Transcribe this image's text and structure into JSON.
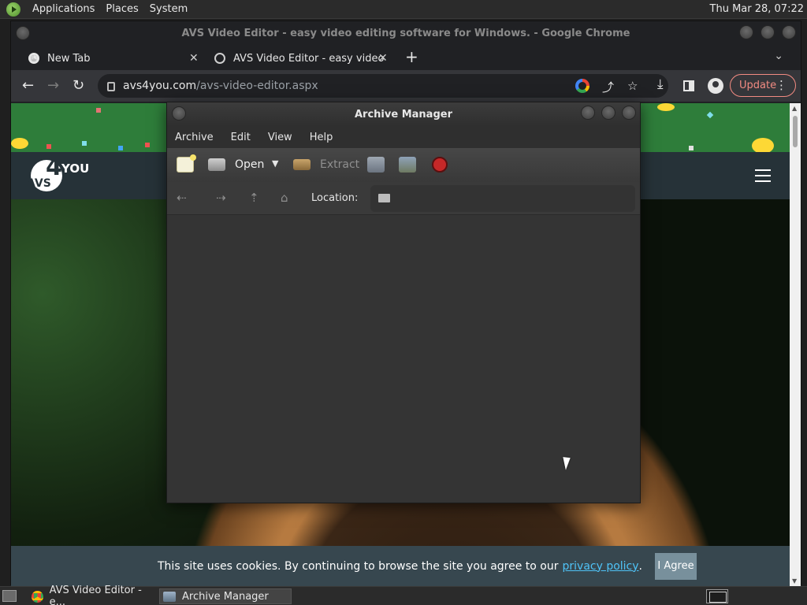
{
  "top_panel": {
    "menus": [
      "Applications",
      "Places",
      "System"
    ],
    "clock": "Thu Mar 28, 07:22"
  },
  "chrome": {
    "window_title": "AVS Video Editor - easy video editing software for Windows. - Google Chrome",
    "tabs": [
      {
        "label": "New Tab",
        "close": "✕"
      },
      {
        "label": "AVS Video Editor - easy video",
        "close": "✕"
      }
    ],
    "new_tab": "+",
    "tab_list": "⌄",
    "nav": {
      "back": "←",
      "forward": "→",
      "reload": "↻"
    },
    "url_host": "avs4you.com",
    "url_path": "/avs-video-editor.aspx",
    "icons": {
      "share": "⤴",
      "star": "☆",
      "download": "⤓"
    },
    "update_label": "Update",
    "menu_dots": "⋮"
  },
  "website": {
    "logo": {
      "avs": "AVS",
      "four": "4",
      "you": "YOU"
    },
    "cookie_text": "This site uses cookies. By continuing to browse the site you agree to our",
    "cookie_link": "privacy policy",
    "cookie_period": ".",
    "agree_label": "I Agree",
    "colors": {
      "header_bg": "#263238",
      "cookie_bg": "#37474f",
      "link": "#4fc3f7"
    }
  },
  "scrollbar": {
    "up": "▲",
    "down": "▼"
  },
  "archive_manager": {
    "title": "Archive Manager",
    "menu": [
      "Archive",
      "Edit",
      "View",
      "Help"
    ],
    "toolbar": {
      "open_label": "Open",
      "open_arrow": "▼",
      "extract_label": "Extract"
    },
    "location": {
      "nav": {
        "back": "⇠",
        "forward": "⇢",
        "up": "⇡",
        "home": "⌂"
      },
      "label": "Location:"
    }
  },
  "taskbar": {
    "tasks": [
      {
        "label": "AVS Video Editor - e..."
      },
      {
        "label": "Archive Manager"
      }
    ]
  }
}
